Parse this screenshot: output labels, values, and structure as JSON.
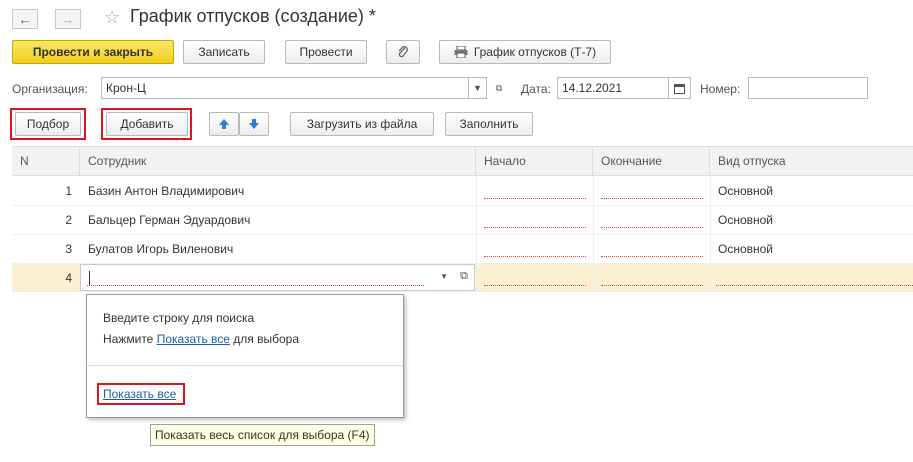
{
  "window": {
    "title": "График отпусков (создание) *"
  },
  "nav": {
    "back_icon": "arrow-left-icon",
    "forward_icon": "arrow-right-icon",
    "favorite_icon": "star-icon"
  },
  "toolbar": {
    "post_close": "Провести и закрыть",
    "save": "Записать",
    "post": "Провести",
    "attach_icon": "paperclip-icon",
    "print_report": "График отпусков (Т-7)"
  },
  "header": {
    "org_label": "Организация:",
    "org_value": "Крон-Ц",
    "date_label": "Дата:",
    "date_value": "14.12.2021",
    "number_label": "Номер:",
    "number_value": ""
  },
  "table_toolbar": {
    "select": "Подбор",
    "add": "Добавить",
    "load_file": "Загрузить из файла",
    "fill": "Заполнить"
  },
  "table": {
    "columns": [
      "N",
      "Сотрудник",
      "Начало",
      "Окончание",
      "Вид отпуска"
    ],
    "rows": [
      {
        "n": "1",
        "employee": "Базин Антон Владимирович",
        "start": "",
        "end": "",
        "type": "Основной"
      },
      {
        "n": "2",
        "employee": "Бальцер Герман Эдуардович",
        "start": "",
        "end": "",
        "type": "Основной"
      },
      {
        "n": "3",
        "employee": "Булатов Игорь Виленович",
        "start": "",
        "end": "",
        "type": "Основной"
      },
      {
        "n": "4",
        "employee": "",
        "start": "",
        "end": "",
        "type": ""
      }
    ]
  },
  "dropdown": {
    "hint_line1": "Введите строку для поиска",
    "hint_line2_prefix": "Нажмите ",
    "hint_line2_link": "Показать все",
    "hint_line2_suffix": " для выбора",
    "show_all": "Показать все"
  },
  "tooltip": "Показать весь список для выбора (F4)"
}
